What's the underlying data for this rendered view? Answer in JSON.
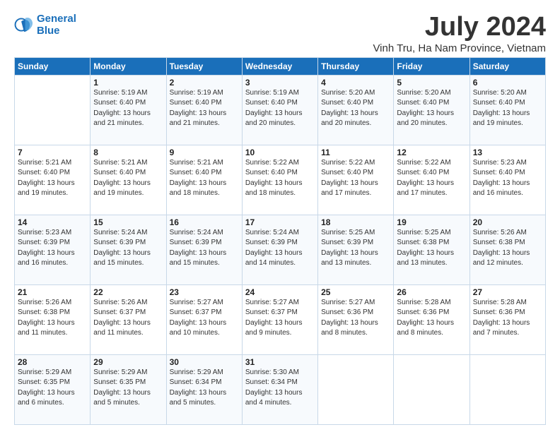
{
  "logo": {
    "line1": "General",
    "line2": "Blue"
  },
  "title": "July 2024",
  "location": "Vinh Tru, Ha Nam Province, Vietnam",
  "days_of_week": [
    "Sunday",
    "Monday",
    "Tuesday",
    "Wednesday",
    "Thursday",
    "Friday",
    "Saturday"
  ],
  "weeks": [
    [
      {
        "day": "",
        "sunrise": "",
        "sunset": "",
        "daylight": ""
      },
      {
        "day": "1",
        "sunrise": "5:19 AM",
        "sunset": "6:40 PM",
        "daylight": "13 hours and 21 minutes."
      },
      {
        "day": "2",
        "sunrise": "5:19 AM",
        "sunset": "6:40 PM",
        "daylight": "13 hours and 21 minutes."
      },
      {
        "day": "3",
        "sunrise": "5:19 AM",
        "sunset": "6:40 PM",
        "daylight": "13 hours and 20 minutes."
      },
      {
        "day": "4",
        "sunrise": "5:20 AM",
        "sunset": "6:40 PM",
        "daylight": "13 hours and 20 minutes."
      },
      {
        "day": "5",
        "sunrise": "5:20 AM",
        "sunset": "6:40 PM",
        "daylight": "13 hours and 20 minutes."
      },
      {
        "day": "6",
        "sunrise": "5:20 AM",
        "sunset": "6:40 PM",
        "daylight": "13 hours and 19 minutes."
      }
    ],
    [
      {
        "day": "7",
        "sunrise": "5:21 AM",
        "sunset": "6:40 PM",
        "daylight": "13 hours and 19 minutes."
      },
      {
        "day": "8",
        "sunrise": "5:21 AM",
        "sunset": "6:40 PM",
        "daylight": "13 hours and 19 minutes."
      },
      {
        "day": "9",
        "sunrise": "5:21 AM",
        "sunset": "6:40 PM",
        "daylight": "13 hours and 18 minutes."
      },
      {
        "day": "10",
        "sunrise": "5:22 AM",
        "sunset": "6:40 PM",
        "daylight": "13 hours and 18 minutes."
      },
      {
        "day": "11",
        "sunrise": "5:22 AM",
        "sunset": "6:40 PM",
        "daylight": "13 hours and 17 minutes."
      },
      {
        "day": "12",
        "sunrise": "5:22 AM",
        "sunset": "6:40 PM",
        "daylight": "13 hours and 17 minutes."
      },
      {
        "day": "13",
        "sunrise": "5:23 AM",
        "sunset": "6:40 PM",
        "daylight": "13 hours and 16 minutes."
      }
    ],
    [
      {
        "day": "14",
        "sunrise": "5:23 AM",
        "sunset": "6:39 PM",
        "daylight": "13 hours and 16 minutes."
      },
      {
        "day": "15",
        "sunrise": "5:24 AM",
        "sunset": "6:39 PM",
        "daylight": "13 hours and 15 minutes."
      },
      {
        "day": "16",
        "sunrise": "5:24 AM",
        "sunset": "6:39 PM",
        "daylight": "13 hours and 15 minutes."
      },
      {
        "day": "17",
        "sunrise": "5:24 AM",
        "sunset": "6:39 PM",
        "daylight": "13 hours and 14 minutes."
      },
      {
        "day": "18",
        "sunrise": "5:25 AM",
        "sunset": "6:39 PM",
        "daylight": "13 hours and 13 minutes."
      },
      {
        "day": "19",
        "sunrise": "5:25 AM",
        "sunset": "6:38 PM",
        "daylight": "13 hours and 13 minutes."
      },
      {
        "day": "20",
        "sunrise": "5:26 AM",
        "sunset": "6:38 PM",
        "daylight": "13 hours and 12 minutes."
      }
    ],
    [
      {
        "day": "21",
        "sunrise": "5:26 AM",
        "sunset": "6:38 PM",
        "daylight": "13 hours and 11 minutes."
      },
      {
        "day": "22",
        "sunrise": "5:26 AM",
        "sunset": "6:37 PM",
        "daylight": "13 hours and 11 minutes."
      },
      {
        "day": "23",
        "sunrise": "5:27 AM",
        "sunset": "6:37 PM",
        "daylight": "13 hours and 10 minutes."
      },
      {
        "day": "24",
        "sunrise": "5:27 AM",
        "sunset": "6:37 PM",
        "daylight": "13 hours and 9 minutes."
      },
      {
        "day": "25",
        "sunrise": "5:27 AM",
        "sunset": "6:36 PM",
        "daylight": "13 hours and 8 minutes."
      },
      {
        "day": "26",
        "sunrise": "5:28 AM",
        "sunset": "6:36 PM",
        "daylight": "13 hours and 8 minutes."
      },
      {
        "day": "27",
        "sunrise": "5:28 AM",
        "sunset": "6:36 PM",
        "daylight": "13 hours and 7 minutes."
      }
    ],
    [
      {
        "day": "28",
        "sunrise": "5:29 AM",
        "sunset": "6:35 PM",
        "daylight": "13 hours and 6 minutes."
      },
      {
        "day": "29",
        "sunrise": "5:29 AM",
        "sunset": "6:35 PM",
        "daylight": "13 hours and 5 minutes."
      },
      {
        "day": "30",
        "sunrise": "5:29 AM",
        "sunset": "6:34 PM",
        "daylight": "13 hours and 5 minutes."
      },
      {
        "day": "31",
        "sunrise": "5:30 AM",
        "sunset": "6:34 PM",
        "daylight": "13 hours and 4 minutes."
      },
      {
        "day": "",
        "sunrise": "",
        "sunset": "",
        "daylight": ""
      },
      {
        "day": "",
        "sunrise": "",
        "sunset": "",
        "daylight": ""
      },
      {
        "day": "",
        "sunrise": "",
        "sunset": "",
        "daylight": ""
      }
    ]
  ]
}
